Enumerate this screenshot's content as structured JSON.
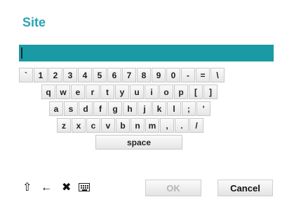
{
  "dialog": {
    "title": "Site"
  },
  "input": {
    "value": ""
  },
  "keyboard": {
    "rows": [
      [
        "`",
        "1",
        "2",
        "3",
        "4",
        "5",
        "6",
        "7",
        "8",
        "9",
        "0",
        "-",
        "=",
        "\\"
      ],
      [
        "q",
        "w",
        "e",
        "r",
        "t",
        "y",
        "u",
        "i",
        "o",
        "p",
        "[",
        "]"
      ],
      [
        "a",
        "s",
        "d",
        "f",
        "g",
        "h",
        "j",
        "k",
        "l",
        ";",
        "'"
      ],
      [
        "z",
        "x",
        "c",
        "v",
        "b",
        "n",
        "m",
        ",",
        ".",
        "/"
      ]
    ],
    "space_label": "space"
  },
  "toolbar": {
    "shift_icon": "⇧",
    "backspace_icon": "←",
    "clear_icon": "✖",
    "keyboard_icon": "keyboard-icon"
  },
  "buttons": {
    "ok": "OK",
    "cancel": "Cancel"
  }
}
